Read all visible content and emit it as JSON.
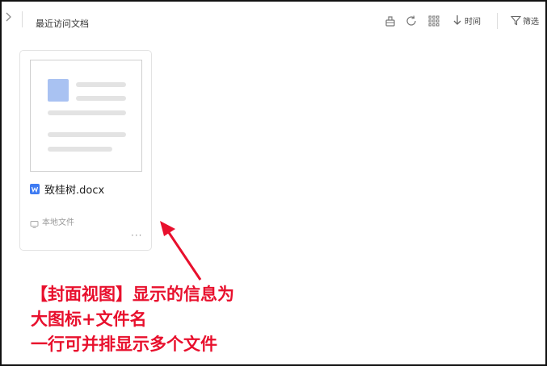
{
  "toolbar": {
    "title": "最近访问文档",
    "sort_label": "时间",
    "filter_label": "筛选",
    "icons": [
      "collapse-chevron-icon",
      "clean-icon",
      "refresh-icon",
      "grid-view-icon",
      "sort-down-icon",
      "filter-icon"
    ]
  },
  "files": [
    {
      "name": "致桂树.docx",
      "location": "本地文件",
      "type_icon": "word-doc-icon",
      "more_label": "···"
    }
  ],
  "annotation": {
    "lines": [
      "【封面视图】显示的信息为",
      "大图标+文件名",
      "一行可并排显示多个文件"
    ],
    "color": "#e8102d"
  },
  "colors": {
    "accent_blue": "#3e7bf2",
    "thumb_blue": "#a9c2f2",
    "annotation_red": "#e8102d"
  }
}
